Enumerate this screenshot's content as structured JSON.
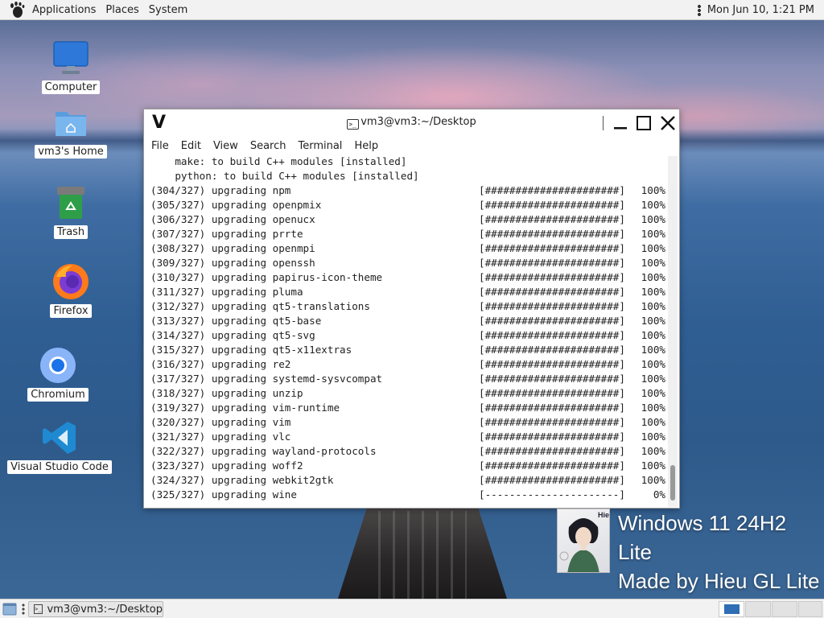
{
  "top_panel": {
    "menus": [
      "Applications",
      "Places",
      "System"
    ],
    "clock": "Mon Jun 10,  1:21 PM"
  },
  "desktop_icons": [
    {
      "label": "Computer",
      "icon": "monitor-icon"
    },
    {
      "label": "vm3's Home",
      "icon": "home-folder-icon"
    },
    {
      "label": "Trash",
      "icon": "trash-icon"
    },
    {
      "label": "Firefox",
      "icon": "firefox-icon"
    },
    {
      "label": "Chromium",
      "icon": "chromium-icon"
    },
    {
      "label": "Visual Studio Code",
      "icon": "vscode-icon"
    }
  ],
  "terminal": {
    "app_letter": "V",
    "title": "vm3@vm3:~/Desktop",
    "menu": [
      "File",
      "Edit",
      "View",
      "Search",
      "Terminal",
      "Help"
    ],
    "header_lines": [
      "    make: to build C++ modules [installed]",
      "    python: to build C++ modules [installed]"
    ],
    "rows": [
      {
        "text": "(304/327) upgrading npm",
        "bar": "[######################]",
        "pct": "100%"
      },
      {
        "text": "(305/327) upgrading openpmix",
        "bar": "[######################]",
        "pct": "100%"
      },
      {
        "text": "(306/327) upgrading openucx",
        "bar": "[######################]",
        "pct": "100%"
      },
      {
        "text": "(307/327) upgrading prrte",
        "bar": "[######################]",
        "pct": "100%"
      },
      {
        "text": "(308/327) upgrading openmpi",
        "bar": "[######################]",
        "pct": "100%"
      },
      {
        "text": "(309/327) upgrading openssh",
        "bar": "[######################]",
        "pct": "100%"
      },
      {
        "text": "(310/327) upgrading papirus-icon-theme",
        "bar": "[######################]",
        "pct": "100%"
      },
      {
        "text": "(311/327) upgrading pluma",
        "bar": "[######################]",
        "pct": "100%"
      },
      {
        "text": "(312/327) upgrading qt5-translations",
        "bar": "[######################]",
        "pct": "100%"
      },
      {
        "text": "(313/327) upgrading qt5-base",
        "bar": "[######################]",
        "pct": "100%"
      },
      {
        "text": "(314/327) upgrading qt5-svg",
        "bar": "[######################]",
        "pct": "100%"
      },
      {
        "text": "(315/327) upgrading qt5-x11extras",
        "bar": "[######################]",
        "pct": "100%"
      },
      {
        "text": "(316/327) upgrading re2",
        "bar": "[######################]",
        "pct": "100%"
      },
      {
        "text": "(317/327) upgrading systemd-sysvcompat",
        "bar": "[######################]",
        "pct": "100%"
      },
      {
        "text": "(318/327) upgrading unzip",
        "bar": "[######################]",
        "pct": "100%"
      },
      {
        "text": "(319/327) upgrading vim-runtime",
        "bar": "[######################]",
        "pct": "100%"
      },
      {
        "text": "(320/327) upgrading vim",
        "bar": "[######################]",
        "pct": "100%"
      },
      {
        "text": "(321/327) upgrading vlc",
        "bar": "[######################]",
        "pct": "100%"
      },
      {
        "text": "(322/327) upgrading wayland-protocols",
        "bar": "[######################]",
        "pct": "100%"
      },
      {
        "text": "(323/327) upgrading woff2",
        "bar": "[######################]",
        "pct": "100%"
      },
      {
        "text": "(324/327) upgrading webkit2gtk",
        "bar": "[######################]",
        "pct": "100%"
      },
      {
        "text": "(325/327) upgrading wine",
        "bar": "[----------------------]",
        "pct": "0%"
      }
    ]
  },
  "watermark": {
    "line1": "Windows 11 24H2 Lite",
    "line2": "Made by Hieu GL Lite",
    "badge_text": "Hieu"
  },
  "bottom_panel": {
    "task_label": "vm3@vm3:~/Desktop"
  },
  "colors": {
    "panel_bg": "#f2f2f2",
    "workspace_active": "#2f6db5"
  }
}
